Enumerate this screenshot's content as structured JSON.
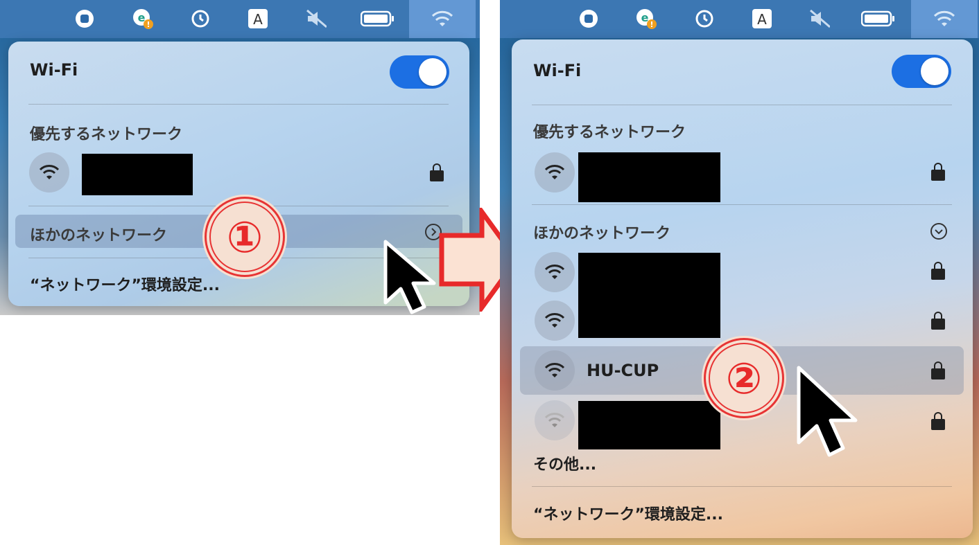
{
  "step1": {
    "wifi_title": "Wi-Fi",
    "preferred_label": "優先するネットワーク",
    "other_networks_label": "ほかのネットワーク",
    "network_prefs": "“ネットワーク”環境設定...",
    "badge": "①"
  },
  "step2": {
    "wifi_title": "Wi-Fi",
    "preferred_label": "優先するネットワーク",
    "other_networks_label": "ほかのネットワーク",
    "highlighted_network": "HU-CUP",
    "other_label": "その他...",
    "network_prefs": "“ネットワーク”環境設定...",
    "badge": "②"
  },
  "menubar_icons": [
    "stop-icon",
    "eset-icon",
    "time-machine-icon",
    "input-source-icon",
    "mute-icon",
    "battery-icon",
    "wifi-icon"
  ],
  "colors": {
    "toggle_on": "#1c6fe3",
    "badge_red": "#e73434",
    "arrow_red": "#e72a2a",
    "arrow_fill": "#fbe2d3"
  }
}
